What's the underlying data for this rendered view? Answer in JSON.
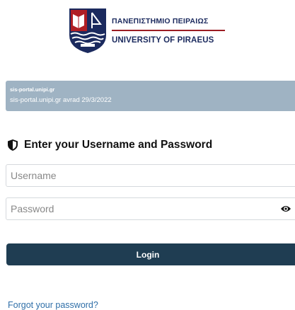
{
  "logo": {
    "greek_name": "ΠΑΝΕΠΙΣΤΗΜΙΟ ΠΕΙΡΑΙΩΣ",
    "english_name": "UNIVERSITY OF PIRAEUS"
  },
  "notice": {
    "title": "sis-portal.unipi.gr",
    "body": "sis-portal.unipi.gr avrad 29/3/2022"
  },
  "login_form": {
    "heading": "Enter your Username and Password",
    "username_placeholder": "Username",
    "password_placeholder": "Password",
    "login_label": "Login",
    "forgot_label": "Forgot your password?"
  },
  "icons": {
    "heading_icon": "shield-icon",
    "password_toggle": "eye-icon"
  },
  "colors": {
    "brand_navy": "#1b2a5e",
    "brand_red": "#9b1c22",
    "notice_bg": "#9fb3c3",
    "button_bg": "#1f3d52",
    "link": "#2f6fa8"
  }
}
